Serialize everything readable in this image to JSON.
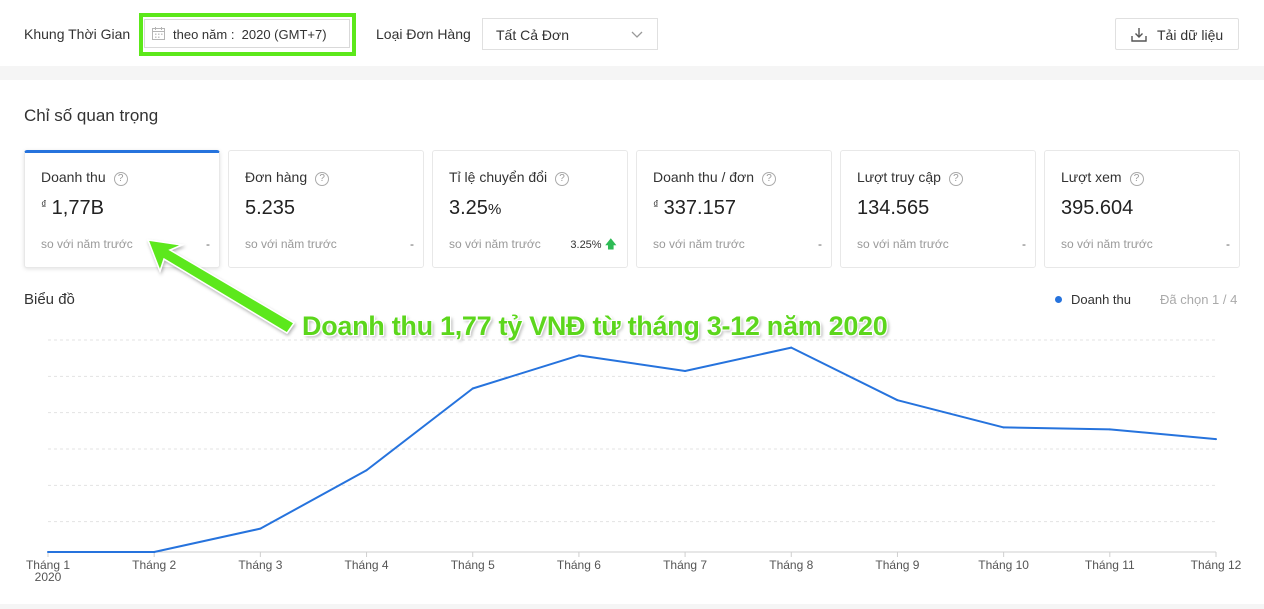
{
  "filters": {
    "time_label": "Khung Thời Gian",
    "date_value": "theo năm :  2020 (GMT+7)",
    "order_type_label": "Loại Đơn Hàng",
    "order_type_value": "Tất Cả Đơn",
    "download_label": "Tải dữ liệu"
  },
  "section_title": "Chỉ số quan trọng",
  "metrics": [
    {
      "label": "Doanh thu",
      "currency": "₫",
      "value": "1,77B",
      "compare": "so với năm trước",
      "change": "-"
    },
    {
      "label": "Đơn hàng",
      "value": "5.235",
      "compare": "so với năm trước",
      "change": "-"
    },
    {
      "label": "Tỉ lệ chuyển đổi",
      "value": "3.25",
      "unit": "%",
      "compare": "so với năm trước",
      "change": "3.25%"
    },
    {
      "label": "Doanh thu / đơn",
      "currency": "₫",
      "value": "337.157",
      "compare": "so với năm trước",
      "change": "-"
    },
    {
      "label": "Lượt truy cập",
      "value": "134.565",
      "compare": "so với năm trước",
      "change": "-"
    },
    {
      "label": "Lượt xem",
      "value": "395.604",
      "compare": "so với năm trước",
      "change": "-"
    }
  ],
  "chart_title": "Biểu đồ",
  "legend": {
    "series": "Doanh thu",
    "selected": "Đã chọn 1 / 4"
  },
  "annotation": "Doanh thu 1,77 tỷ VNĐ từ tháng 3-12 năm 2020",
  "colors": {
    "accent": "#2673dd",
    "highlight": "#5ce81a",
    "up": "#2ebb55"
  },
  "chart_data": {
    "type": "line",
    "categories": [
      "Tháng 1",
      "Tháng 2",
      "Tháng 3",
      "Tháng 4",
      "Tháng 5",
      "Tháng 6",
      "Tháng 7",
      "Tháng 8",
      "Tháng 9",
      "Tháng 10",
      "Tháng 11",
      "Tháng 12"
    ],
    "x_sub_label": "2020",
    "series": [
      {
        "name": "Doanh thu",
        "values": [
          0,
          0,
          0.6,
          2.1,
          4.2,
          5.05,
          4.65,
          5.25,
          3.9,
          3.2,
          3.15,
          2.9
        ],
        "color": "#2673dd"
      }
    ],
    "ylim": [
      0,
      5.6
    ],
    "gridlines": 6,
    "y_ticks_shown": false,
    "grid": true
  }
}
